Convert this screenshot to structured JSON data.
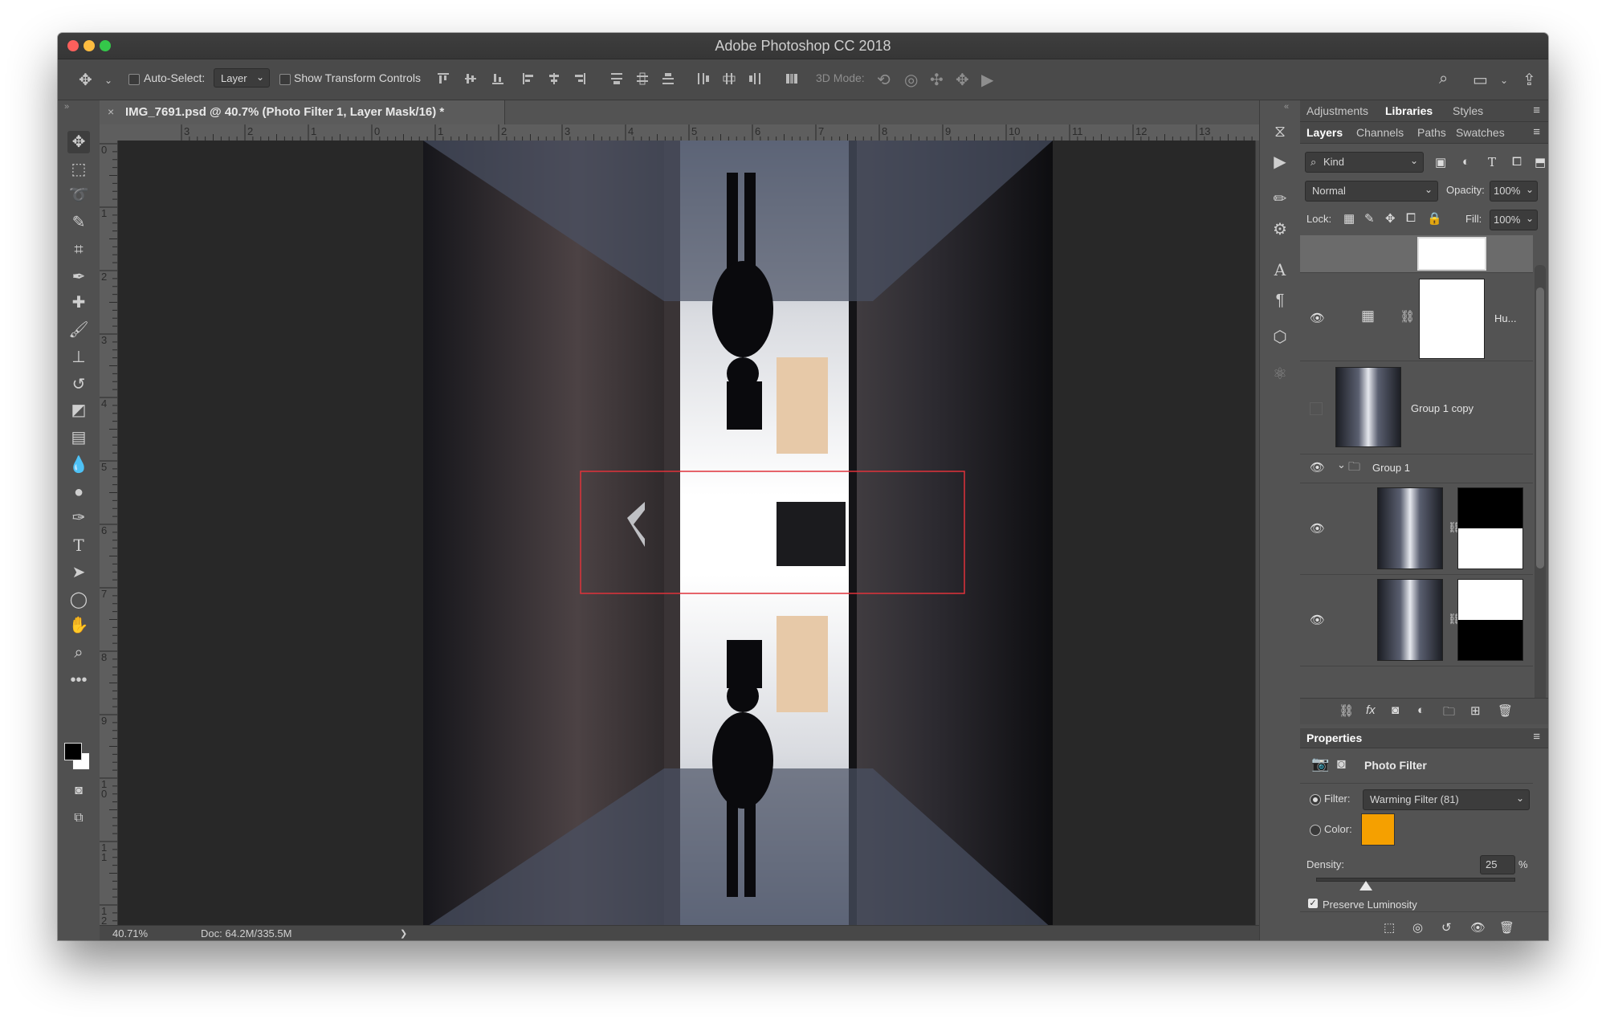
{
  "window": {
    "title": "Adobe Photoshop CC 2018",
    "traffic_colors": [
      "#fc605c",
      "#fdbc40",
      "#34c84a"
    ]
  },
  "options_bar": {
    "auto_select_label": "Auto-Select:",
    "auto_select_value": "Layer",
    "show_transform_label": "Show Transform Controls",
    "mode_3d_label": "3D Mode:"
  },
  "document": {
    "tab_title": "IMG_7691.psd @ 40.7% (Photo Filter 1, Layer Mask/16) *",
    "close_glyph": "×",
    "zoom": "40.71%",
    "doc_size": "Doc: 64.2M/335.5M",
    "status_arrow": "❯"
  },
  "rulers": {
    "horizontal": [
      "3",
      "2",
      "1",
      "0",
      "1",
      "2",
      "3",
      "4",
      "5",
      "6",
      "7",
      "8",
      "9",
      "10",
      "11",
      "12",
      "13"
    ],
    "vertical": [
      "0",
      "1",
      "2",
      "3",
      "4",
      "5",
      "6",
      "7",
      "8",
      "9",
      "1 0",
      "1 1",
      "1 2"
    ]
  },
  "panels": {
    "top_tabs": [
      "Adjustments",
      "Libraries",
      "Styles"
    ],
    "top_tab_active": "Libraries",
    "layer_tabs": [
      "Layers",
      "Channels",
      "Paths",
      "Swatches"
    ],
    "layer_tab_active": "Layers",
    "filter_kind": "Kind",
    "blend_mode": "Normal",
    "opacity_label": "Opacity:",
    "opacity_value": "100%",
    "lock_label": "Lock:",
    "fill_label": "Fill:",
    "fill_value": "100%",
    "layers": [
      {
        "name": "Hu...",
        "visible": true
      },
      {
        "name": "Group 1 copy",
        "visible": false
      },
      {
        "name": "Group 1",
        "visible": true
      },
      {
        "name": "",
        "visible": true
      },
      {
        "name": "",
        "visible": true
      }
    ]
  },
  "properties": {
    "panel_title": "Properties",
    "adjustment_title": "Photo Filter",
    "filter_label": "Filter:",
    "filter_value": "Warming Filter (81)",
    "color_label": "Color:",
    "color_swatch": "#f5a000",
    "density_label": "Density:",
    "density_value": "25",
    "density_unit": "%",
    "density_percent": 25,
    "preserve_luminosity_label": "Preserve Luminosity",
    "preserve_luminosity_checked": true
  },
  "icons": {
    "move": "move-icon",
    "marquee": "marquee-icon",
    "lasso": "lasso-icon",
    "eye": "eye-icon",
    "link": "link-icon",
    "search": "search-icon"
  }
}
